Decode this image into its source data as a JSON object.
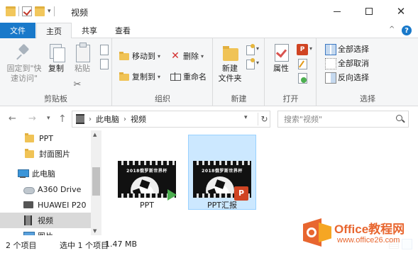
{
  "window": {
    "title": "视频",
    "minimize_icon": "minimize-icon",
    "maximize_icon": "maximize-icon",
    "close_icon": "close-icon"
  },
  "tabs": {
    "file": "文件",
    "home": "主页",
    "share": "共享",
    "view": "查看",
    "collapse_glyph": "^",
    "help_glyph": "?"
  },
  "ribbon": {
    "clipboard": {
      "label": "剪贴板",
      "pin_label_line1": "固定到\"快",
      "pin_label_line2": "速访问\"",
      "copy_label": "复制",
      "paste_label": "粘贴"
    },
    "organize": {
      "label": "组织",
      "move_to": "移动到",
      "copy_to": "复制到",
      "delete": "删除",
      "rename": "重命名"
    },
    "new": {
      "label": "新建",
      "new_folder_line1": "新建",
      "new_folder_line2": "文件夹"
    },
    "open": {
      "label": "打开",
      "properties": "属性"
    },
    "select": {
      "label": "选择",
      "select_all": "全部选择",
      "select_none": "全部取消",
      "invert": "反向选择"
    }
  },
  "address": {
    "crumbs": [
      "此电脑",
      "视频"
    ],
    "search_placeholder": "搜索\"视频\""
  },
  "nav_pane": {
    "items": [
      {
        "label": "PPT",
        "icon": "folder-icon"
      },
      {
        "label": "封面图片",
        "icon": "folder-icon"
      },
      {
        "label": "此电脑",
        "icon": "computer-icon"
      },
      {
        "label": "A360 Drive",
        "icon": "cloud-drive-icon"
      },
      {
        "label": "HUAWEI P20",
        "icon": "phone-icon"
      },
      {
        "label": "视频",
        "icon": "video-folder-icon",
        "selected": true
      },
      {
        "label": "图片",
        "icon": "pictures-icon"
      }
    ]
  },
  "files": [
    {
      "name": "PPT",
      "thumb_caption": "2018俄罗斯世界杯",
      "badge": "play-icon",
      "selected": false
    },
    {
      "name": "PPT汇报",
      "thumb_caption": "2018俄罗斯世界杯",
      "badge": "powerpoint-icon",
      "badge_text": "P",
      "selected": true
    }
  ],
  "status": {
    "count": "2 个项目",
    "selected": "选中 1 个项目",
    "size": "1.47 MB"
  },
  "watermark": {
    "title": "Office教程网",
    "url": "www.office26.com"
  },
  "colors": {
    "accent": "#1979ca",
    "selection_bg": "#cce8ff",
    "watermark_orange": "#e8662f"
  }
}
